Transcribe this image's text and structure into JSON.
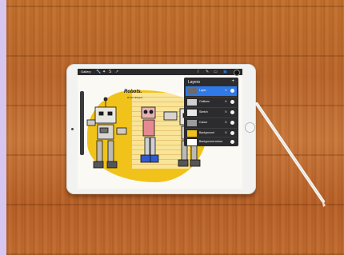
{
  "app": {
    "gallery_label": "Gallery",
    "toolbar_icons": [
      "wrench-icon",
      "magic-wand-icon",
      "select-icon",
      "transform-icon"
    ],
    "brush_icons": [
      "brush-icon",
      "smudge-icon",
      "eraser-icon",
      "layers-icon",
      "color-swatch-icon"
    ]
  },
  "artwork": {
    "title": "Robots.",
    "subtitle": "Robot designs",
    "background_color": "#f1c31a"
  },
  "layers_panel": {
    "title": "Layers",
    "add_symbol": "+",
    "layers": [
      {
        "name": "Layer",
        "mode": "N",
        "visible": true,
        "active": true,
        "thumb_color": "#6b6b6b"
      },
      {
        "name": "Outlines",
        "mode": "N",
        "visible": true,
        "active": false,
        "thumb_color": "#cfcfcf"
      },
      {
        "name": "Sketch",
        "mode": "N",
        "visible": true,
        "active": false,
        "thumb_color": "#e8e8e8"
      },
      {
        "name": "Colour",
        "mode": "N",
        "visible": true,
        "active": false,
        "thumb_color": "#9b9b9b"
      },
      {
        "name": "Background",
        "mode": "N",
        "visible": true,
        "active": false,
        "thumb_color": "#f1c31a"
      },
      {
        "name": "Background colour",
        "mode": "",
        "visible": true,
        "active": false,
        "thumb_color": "#ffffff"
      }
    ]
  }
}
